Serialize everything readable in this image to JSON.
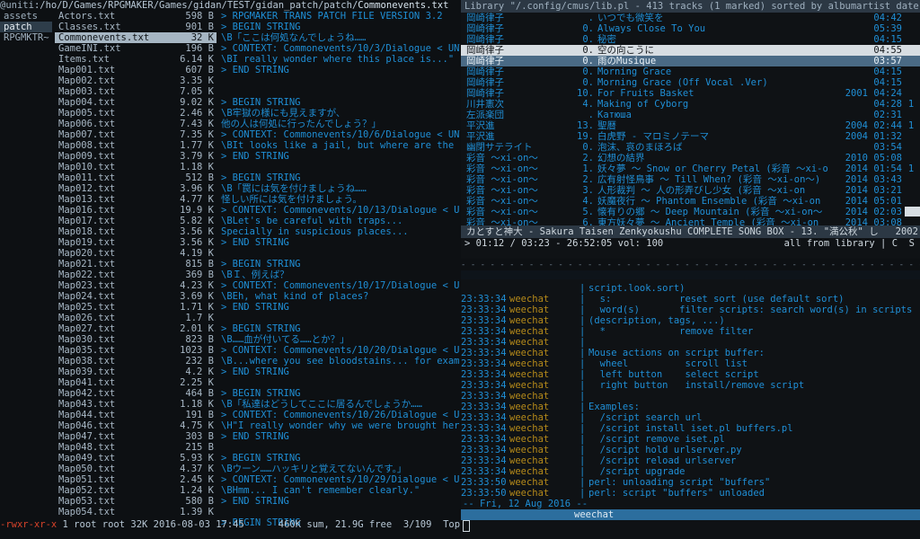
{
  "ranger": {
    "header": {
      "user": "@uniti",
      "path": ":/ho/D/Games/RPGMAKER/Games/gidan/TEST/gidan_patch/patch/",
      "file": "Commonevents.txt"
    },
    "parent_dirs": [
      {
        "name": "assets",
        "selected": false
      },
      {
        "name": "patch",
        "selected": true
      },
      {
        "name": "RPGMKTR~",
        "selected": false
      }
    ],
    "files": [
      {
        "name": "Actors.txt",
        "size": "598 B"
      },
      {
        "name": "Classes.txt",
        "size": "901 B"
      },
      {
        "name": "Commonevents.txt",
        "size": "32 K",
        "selected": true
      },
      {
        "name": "GameINI.txt",
        "size": "196 B"
      },
      {
        "name": "Items.txt",
        "size": "6.14 K"
      },
      {
        "name": "Map001.txt",
        "size": "607 B"
      },
      {
        "name": "Map002.txt",
        "size": "3.35 K"
      },
      {
        "name": "Map003.txt",
        "size": "7.05 K"
      },
      {
        "name": "Map004.txt",
        "size": "9.02 K"
      },
      {
        "name": "Map005.txt",
        "size": "2.46 K"
      },
      {
        "name": "Map006.txt",
        "size": "7.43 K"
      },
      {
        "name": "Map007.txt",
        "size": "7.35 K"
      },
      {
        "name": "Map008.txt",
        "size": "1.77 K"
      },
      {
        "name": "Map009.txt",
        "size": "3.79 K"
      },
      {
        "name": "Map010.txt",
        "size": "1.18 K"
      },
      {
        "name": "Map011.txt",
        "size": "512 B"
      },
      {
        "name": "Map012.txt",
        "size": "3.96 K"
      },
      {
        "name": "Map013.txt",
        "size": "4.77 K"
      },
      {
        "name": "Map016.txt",
        "size": "19.9 K"
      },
      {
        "name": "Map017.txt",
        "size": "5.82 K"
      },
      {
        "name": "Map018.txt",
        "size": "3.56 K"
      },
      {
        "name": "Map019.txt",
        "size": "3.56 K"
      },
      {
        "name": "Map020.txt",
        "size": "4.19 K"
      },
      {
        "name": "Map021.txt",
        "size": "815 B"
      },
      {
        "name": "Map022.txt",
        "size": "369 B"
      },
      {
        "name": "Map023.txt",
        "size": "4.23 K"
      },
      {
        "name": "Map024.txt",
        "size": "3.69 K"
      },
      {
        "name": "Map025.txt",
        "size": "1.71 K"
      },
      {
        "name": "Map026.txt",
        "size": "1.7 K"
      },
      {
        "name": "Map027.txt",
        "size": "2.01 K"
      },
      {
        "name": "Map030.txt",
        "size": "823 B"
      },
      {
        "name": "Map035.txt",
        "size": "1023 B"
      },
      {
        "name": "Map038.txt",
        "size": "232 B"
      },
      {
        "name": "Map039.txt",
        "size": "4.2 K"
      },
      {
        "name": "Map041.txt",
        "size": "2.25 K"
      },
      {
        "name": "Map042.txt",
        "size": "464 B"
      },
      {
        "name": "Map043.txt",
        "size": "1.18 K"
      },
      {
        "name": "Map044.txt",
        "size": "191 B"
      },
      {
        "name": "Map046.txt",
        "size": "4.75 K"
      },
      {
        "name": "Map047.txt",
        "size": "303 B"
      },
      {
        "name": "Map048.txt",
        "size": "215 B"
      },
      {
        "name": "Map049.txt",
        "size": "5.93 K"
      },
      {
        "name": "Map050.txt",
        "size": "4.37 K"
      },
      {
        "name": "Map051.txt",
        "size": "2.45 K"
      },
      {
        "name": "Map052.txt",
        "size": "1.24 K"
      },
      {
        "name": "Map053.txt",
        "size": "580 B"
      },
      {
        "name": "Map054.txt",
        "size": "1.39 K"
      }
    ],
    "preview_lines": [
      "> RPGMAKER TRANS PATCH FILE VERSION 3.2",
      "> BEGIN STRING",
      "\\B「ここは何処なんでしょうね……",
      "> CONTEXT: Commonevents/10/3/Dialogue < UNTR",
      "\\BI really wonder where this place is...\"",
      "> END STRING",
      "",
      "",
      "> BEGIN STRING",
      "\\B牢獄の様にも見えますが、",
      "他の人は何処に行ったんでしょう？」",
      "> CONTEXT: Commonevents/10/6/Dialogue < UNTR",
      "\\BIt looks like a jail, but where are the o",
      "> END STRING",
      "",
      "> BEGIN STRING",
      "\\B「罠には気を付けましょうね……",
      "怪しい所には気を付けましょう。",
      "> CONTEXT: Commonevents/10/13/Dialogue < UNT",
      "\\BLet's be careful with traps...",
      "Specially in suspicious places...",
      "> END STRING",
      "",
      "> BEGIN STRING",
      "\\BＩ、例えば？",
      "> CONTEXT: Commonevents/10/17/Dialogue < UNT",
      "\\BEh, what kind of places?",
      "> END STRING",
      "",
      "> BEGIN STRING",
      "\\B……血が付いてる……とか？」",
      "> CONTEXT: Commonevents/10/20/Dialogue < UNT",
      "\\B...where you see bloodstains... for examp",
      "> END STRING",
      "",
      "> BEGIN STRING",
      "\\B「私達はどうしてここに居るんでしょうか……",
      "> CONTEXT: Commonevents/10/26/Dialogue < UNT",
      "\\H\"I really wonder why we were brought here",
      "> END STRING",
      "",
      "> BEGIN STRING",
      "\\Bウーン……ハッキリと覚えてないんです。」",
      "> CONTEXT: Commonevents/10/29/Dialogue < UNT",
      "\\BHmm... I can't remember clearly.\"",
      "> END STRING",
      "",
      "> BEGIN STRING"
    ],
    "status": {
      "perm": "-rwxr-xr-x",
      "info": " 1 root root 32K 2016-08-03 17:45      460K sum, 21.9G free  3/109  Top"
    }
  },
  "cmus": {
    "title": "Library \"/.config/cmus/lib.pl - 413 tracks (1 marked) sorted by albumartist date al",
    "tracks": [
      {
        "artist": "岡崎律子",
        "num": ".",
        "title": "いつでも微笑を",
        "year": "",
        "dur": "04:42",
        "tail": ""
      },
      {
        "artist": "岡崎律子",
        "num": "0.",
        "title": "Always Close To You",
        "year": "",
        "dur": "05:39",
        "tail": ""
      },
      {
        "artist": "岡崎律子",
        "num": "0.",
        "title": "秘密",
        "year": "",
        "dur": "04:15",
        "tail": ""
      },
      {
        "artist": "岡崎律子",
        "num": "0.",
        "title": "空の向こうに",
        "year": "",
        "dur": "04:55",
        "tail": "",
        "state": "cur"
      },
      {
        "artist": "岡崎律子",
        "num": "0.",
        "title": "雨のMusique",
        "year": "",
        "dur": "03:57",
        "tail": "",
        "state": "sel"
      },
      {
        "artist": "岡崎律子",
        "num": "0.",
        "title": "Morning Grace",
        "year": "",
        "dur": "04:15",
        "tail": ""
      },
      {
        "artist": "岡崎律子",
        "num": "0.",
        "title": "Morning Grace (Off Vocal .Ver)",
        "year": "",
        "dur": "04:15",
        "tail": ""
      },
      {
        "artist": "岡崎律子",
        "num": "10.",
        "title": "For Fruits Basket",
        "year": "2001",
        "dur": "04:24",
        "tail": ""
      },
      {
        "artist": "川井憲次",
        "num": "4.",
        "title": "Making of Cyborg",
        "year": "",
        "dur": "04:28",
        "tail": "1"
      },
      {
        "artist": "左派楽団",
        "num": ".",
        "title": "Катюша",
        "year": "",
        "dur": "02:31",
        "tail": ""
      },
      {
        "artist": "平沢進",
        "num": "13.",
        "title": "聖暦",
        "year": "2004",
        "dur": "02:44",
        "tail": "1"
      },
      {
        "artist": "平沢進",
        "num": "19.",
        "title": "白虎野 - マロミノテーマ",
        "year": "2004",
        "dur": "01:32",
        "tail": ""
      },
      {
        "artist": "幽閉サテライト",
        "num": "0.",
        "title": "泡沫、哀のまほろば",
        "year": "",
        "dur": "03:54",
        "tail": ""
      },
      {
        "artist": "彩音 ～xi-on～",
        "num": "2.",
        "title": "幻想の結界",
        "year": "2010",
        "dur": "05:08",
        "tail": ""
      },
      {
        "artist": "彩音 ～xi-on～",
        "num": "1.",
        "title": "妖々夢 ～ Snow or Cherry Petal (彩音 ～xi-o",
        "year": "2014",
        "dur": "01:54",
        "tail": "1"
      },
      {
        "artist": "彩音 ～xi-on～",
        "num": "2.",
        "title": "広有射怪鳥事 ～ Till When? (彩音 ～xi-on～)",
        "year": "2014",
        "dur": "03:43",
        "tail": ""
      },
      {
        "artist": "彩音 ～xi-on～",
        "num": "3.",
        "title": "人形裁判 ～ 人の形弄びし少女 (彩音 ～xi-on",
        "year": "2014",
        "dur": "03:21",
        "tail": ""
      },
      {
        "artist": "彩音 ～xi-on～",
        "num": "4.",
        "title": "妖魔夜行 ～ Phantom Ensemble (彩音 ～xi-on",
        "year": "2014",
        "dur": "05:01",
        "tail": ""
      },
      {
        "artist": "彩音 ～xi-on～",
        "num": "5.",
        "title": "懐有りの郷 ～ Deep Mountain (彩音 ～xi-on～",
        "year": "2014",
        "dur": "02:03",
        "tail": ""
      },
      {
        "artist": "彩音 ～xi-on～",
        "num": "6.",
        "title": "東方妖々夢 ～ Ancient Temple (彩音 ～xi-on",
        "year": "2014",
        "dur": "03:08",
        "tail": ""
      }
    ],
    "now_playing": "カとすと神大 - Sakura Taisen Zenkyokushu COMPLETE SONG BOX - 13. \"満公秋\" し   2002",
    "status_left": "> 01:12 / 03:23 - 26:52:05 vol: 100",
    "status_right": "all from library | C  S"
  },
  "weechat": {
    "separator": "- - - - - - - - - - - - - - - - - - - - - - - - - - - - - - - - - - - - - - - - - - - - - - - - - - - - - - - - - - - - - - - - - - - - - - - - - - - - - - - - - - - -",
    "lines": [
      {
        "time": "",
        "nick": "",
        "msg": "script.look.sort)"
      },
      {
        "time": "23:33:34",
        "nick": "weechat",
        "msg": "  s:            reset sort (use default sort)"
      },
      {
        "time": "23:33:34",
        "nick": "weechat",
        "msg": "  word(s)       filter scripts: search word(s) in scripts"
      },
      {
        "time": "23:33:34",
        "nick": "weechat",
        "msg": "(description, tags, ...)"
      },
      {
        "time": "23:33:34",
        "nick": "weechat",
        "msg": "  *             remove filter"
      },
      {
        "time": "23:33:34",
        "nick": "weechat",
        "msg": ""
      },
      {
        "time": "23:33:34",
        "nick": "weechat",
        "msg": "Mouse actions on script buffer:"
      },
      {
        "time": "23:33:34",
        "nick": "weechat",
        "msg": "  wheel          scroll list"
      },
      {
        "time": "23:33:34",
        "nick": "weechat",
        "msg": "  left button    select script"
      },
      {
        "time": "23:33:34",
        "nick": "weechat",
        "msg": "  right button   install/remove script"
      },
      {
        "time": "23:33:34",
        "nick": "weechat",
        "msg": ""
      },
      {
        "time": "23:33:34",
        "nick": "weechat",
        "msg": "Examples:"
      },
      {
        "time": "23:33:34",
        "nick": "weechat",
        "msg": "  /script search url"
      },
      {
        "time": "23:33:34",
        "nick": "weechat",
        "msg": "  /script install iset.pl buffers.pl"
      },
      {
        "time": "23:33:34",
        "nick": "weechat",
        "msg": "  /script remove iset.pl"
      },
      {
        "time": "23:33:34",
        "nick": "weechat",
        "msg": "  /script hold urlserver.py"
      },
      {
        "time": "23:33:34",
        "nick": "weechat",
        "msg": "  /script reload urlserver"
      },
      {
        "time": "23:33:34",
        "nick": "weechat",
        "msg": "  /script upgrade"
      },
      {
        "time": "23:33:50",
        "nick": "weechat",
        "msg": "perl: unloading script \"buffers\""
      },
      {
        "time": "23:33:50",
        "nick": "weechat",
        "msg": "perl: script \"buffers\" unloaded"
      }
    ],
    "date_bar": "-- Fri, 12 Aug 2016 --",
    "buffer_name": "weechat"
  }
}
